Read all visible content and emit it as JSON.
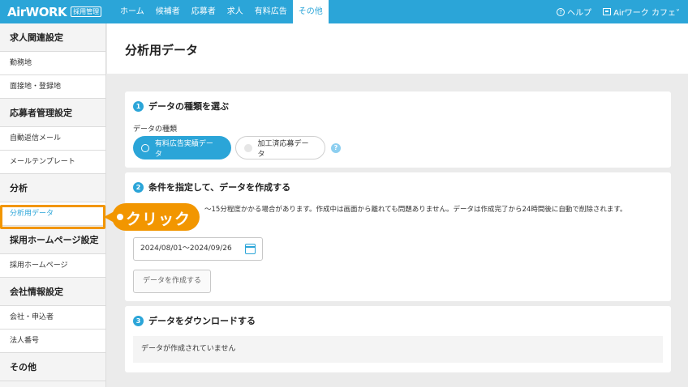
{
  "header": {
    "logo_text": "AirWORK",
    "logo_badge": "採用管理",
    "nav": [
      "ホーム",
      "候補者",
      "応募者",
      "求人",
      "有料広告",
      "その他"
    ],
    "help_label": "ヘルプ",
    "account_label": "Airワーク カフェ˅"
  },
  "sidebar": {
    "sections": [
      {
        "title": "求人関連設定",
        "items": [
          "勤務地",
          "面接地・登録地"
        ]
      },
      {
        "title": "応募者管理設定",
        "items": [
          "自動返信メール",
          "メールテンプレート"
        ]
      },
      {
        "title": "分析",
        "items": [
          "分析用データ"
        ]
      },
      {
        "title": "採用ホームページ設定",
        "items": [
          "採用ホームページ"
        ]
      },
      {
        "title": "会社情報設定",
        "items": [
          "会社・申込者",
          "法人番号"
        ]
      },
      {
        "title": "その他",
        "items": []
      }
    ]
  },
  "callout": {
    "text": "クリック"
  },
  "page": {
    "title": "分析用データ"
  },
  "step1": {
    "num": "1",
    "title": "データの種類を選ぶ",
    "field_label": "データの種類",
    "options": [
      "有料広告実績データ",
      "加工済応募データ"
    ],
    "selected": "有料広告実績データ",
    "help": "?"
  },
  "step2": {
    "num": "2",
    "title": "条件を指定して、データを作成する",
    "note": "～15分程度かかる場合があります。作成中は画面から離れても問題ありません。データは作成完了から24時間後に自動で削除されます。",
    "date_range": "2024/08/01～2024/09/26",
    "create_button": "データを作成する"
  },
  "step3": {
    "num": "3",
    "title": "データをダウンロードする",
    "empty_message": "データが作成されていません"
  },
  "colors": {
    "primary": "#2ba5d8",
    "accent": "#f29600"
  }
}
